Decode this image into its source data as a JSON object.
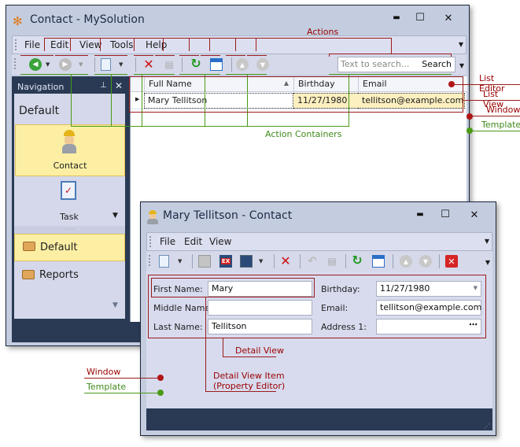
{
  "main_window": {
    "title": "Contact - MySolution",
    "controls": {
      "minimize": "▬",
      "maximize": "☐",
      "close": "✕"
    },
    "menu": [
      "File",
      "Edit",
      "View",
      "Tools",
      "Help"
    ],
    "search": {
      "placeholder": "Text to search...",
      "button": "Search"
    },
    "navigation": {
      "header": "Navigation",
      "group": "Default",
      "items": [
        {
          "label": "Contact",
          "icon": "person-hardhat-icon",
          "selected": true
        },
        {
          "label": "Task",
          "icon": "clipboard-check-icon",
          "selected": false
        }
      ],
      "folders": [
        {
          "label": "Default",
          "selected": true
        },
        {
          "label": "Reports",
          "selected": false
        }
      ]
    },
    "grid": {
      "columns": [
        "Full Name",
        "Birthday",
        "Email"
      ],
      "rows": [
        {
          "full_name": "Mary Tellitson",
          "birthday": "11/27/1980",
          "email": "tellitson@example.com"
        }
      ]
    }
  },
  "detail_window": {
    "title": "Mary Tellitson  - Contact",
    "controls": {
      "minimize": "▬",
      "maximize": "☐",
      "close": "✕"
    },
    "menu": [
      "File",
      "Edit",
      "View"
    ],
    "fields": {
      "first_name": {
        "label": "First Name:",
        "value": "Mary"
      },
      "middle_name": {
        "label": "Middle Name:",
        "value": ""
      },
      "last_name": {
        "label": "Last Name:",
        "value": "Tellitson"
      },
      "birthday": {
        "label": "Birthday:",
        "value": "11/27/1980"
      },
      "email": {
        "label": "Email:",
        "value": "tellitson@example.com"
      },
      "address": {
        "label": "Address 1:",
        "value": ""
      }
    }
  },
  "annotations": {
    "actions": "Actions",
    "action_containers": "Action Containers",
    "list_editor": "List Editor",
    "list_view": "List View",
    "window": "Window",
    "template": "Template",
    "detail_view": "Detail View",
    "detail_view_item_1": "Detail View Item",
    "detail_view_item_2": "(Property Editor)",
    "window2": "Window",
    "template2": "Template"
  },
  "colors": {
    "annotation_red": "#9b1c1c",
    "annotation_green": "#4a9a16",
    "selection": "#fcefa4",
    "dark_frame": "#2a3a55"
  }
}
